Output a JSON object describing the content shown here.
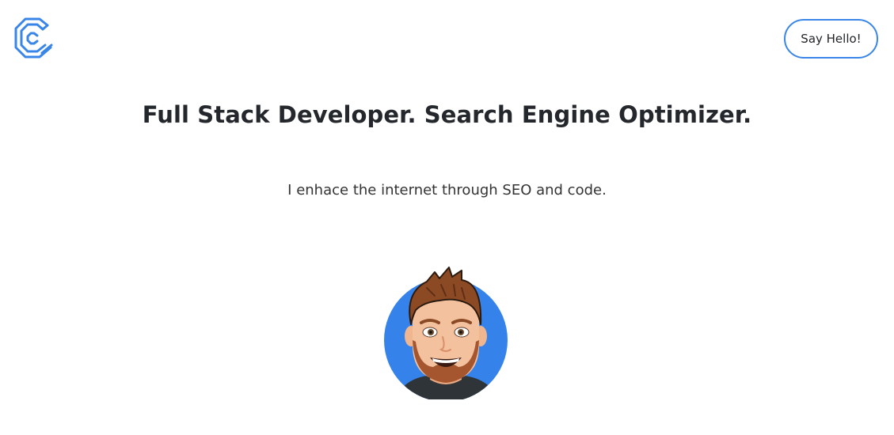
{
  "header": {
    "logo_icon": "c-hexagon-logo-icon",
    "cta_label": "Say Hello!"
  },
  "hero": {
    "headline": "Full Stack Developer. Search Engine Optimizer.",
    "tagline": "I enhace the internet through SEO and code.",
    "avatar_icon": "memoji-avatar"
  },
  "colors": {
    "accent": "#3a86e8",
    "text": "#24272b",
    "avatar_bg": "#3583ea"
  }
}
